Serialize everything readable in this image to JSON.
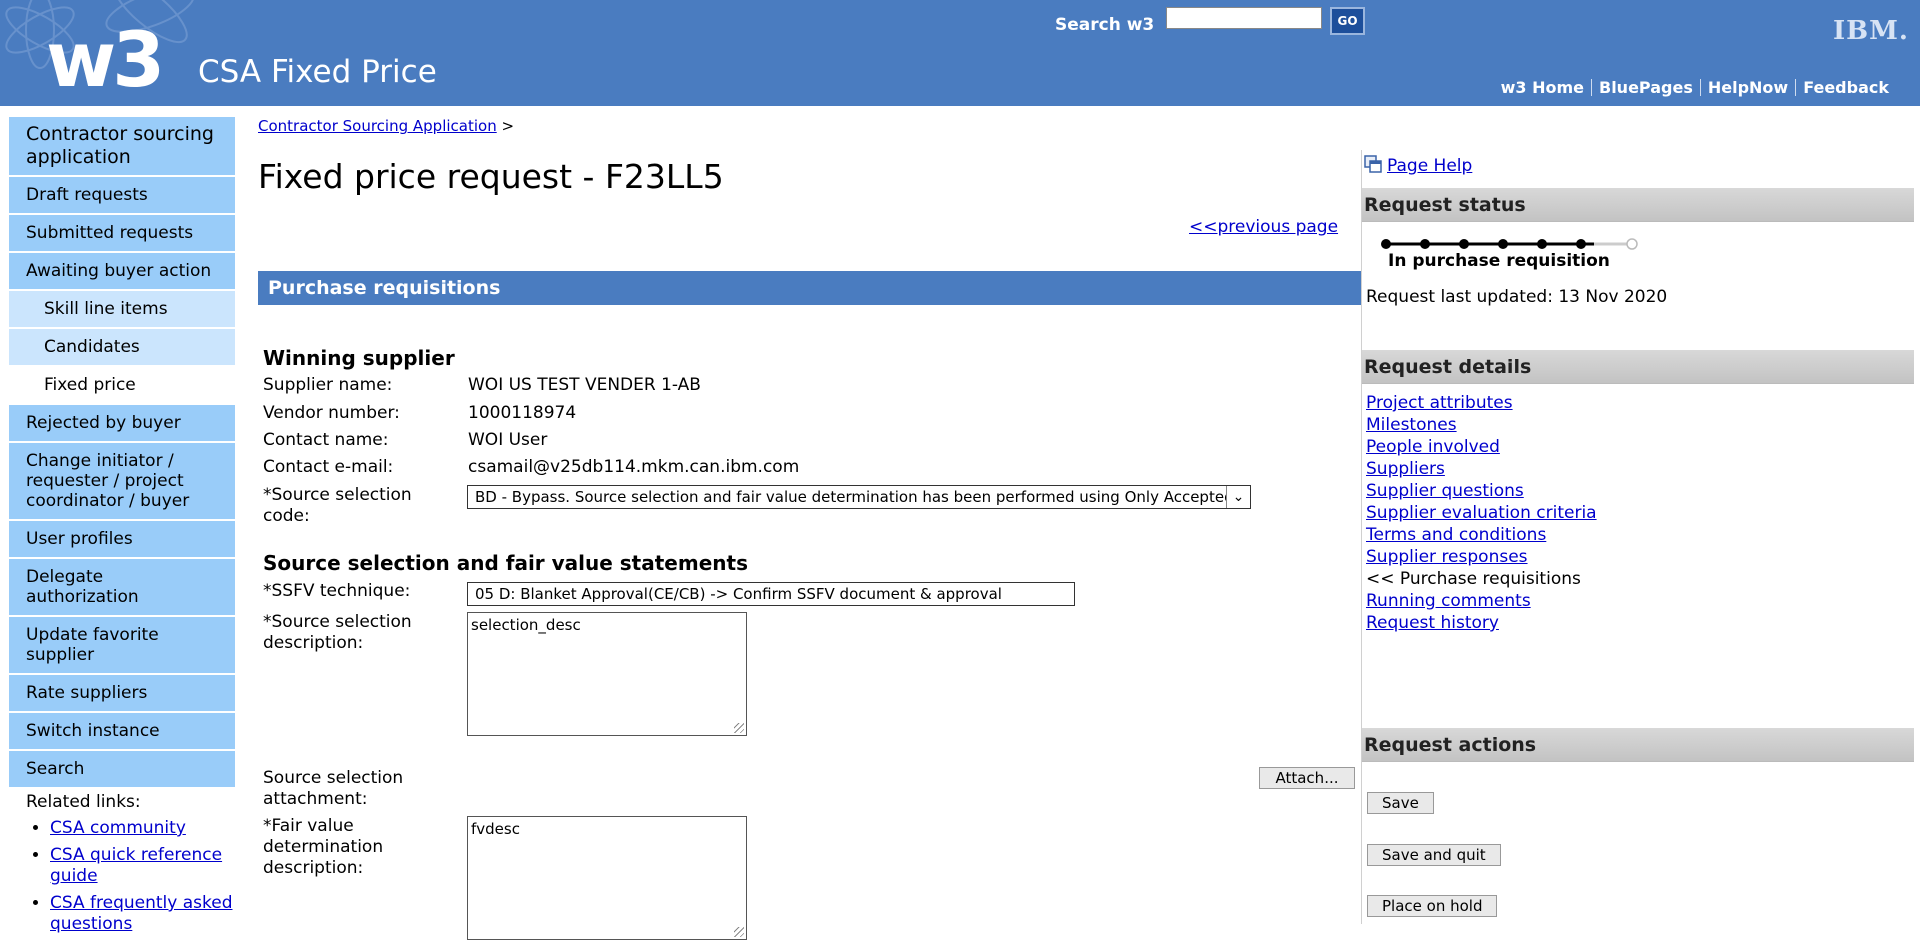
{
  "header": {
    "logo": "w3",
    "app_title": "CSA Fixed Price",
    "search_label": "Search w3",
    "search_value": "",
    "go_label": "GO",
    "ibm_logo": "IBM.",
    "links": [
      "w3 Home",
      "BluePages",
      "HelpNow",
      "Feedback"
    ]
  },
  "leftnav": {
    "title": "Contractor sourcing application",
    "items": [
      "Draft requests",
      "Submitted requests",
      "Awaiting buyer action",
      "Skill line items",
      "Candidates",
      "Fixed price",
      "Rejected by buyer",
      "Change initiator / requester / project coordinator / buyer",
      "User profiles",
      "Delegate authorization",
      "Update favorite supplier",
      "Rate suppliers",
      "Switch instance",
      "Search"
    ],
    "related_title": "Related links:",
    "related_links": [
      "CSA community",
      "CSA quick reference guide",
      "CSA frequently asked questions"
    ]
  },
  "main": {
    "breadcrumb_link": "Contractor Sourcing Application",
    "breadcrumb_sep": ">",
    "page_title": "Fixed price request - F23LL5",
    "prev_link": "<<previous page",
    "section_title": "Purchase requisitions",
    "winning_supplier_title": "Winning supplier",
    "supplier_name_label": "Supplier name:",
    "supplier_name": "WOI US TEST VENDER 1-AB",
    "vendor_number_label": "Vendor number:",
    "vendor_number": "1000118974",
    "contact_name_label": "Contact name:",
    "contact_name": "WOI User",
    "contact_email_label": "Contact e-mail:",
    "contact_email": "csamail@v25db114.mkm.can.ibm.com",
    "source_code_label": "*Source selection code:",
    "source_code_value": "BD - Bypass. Source selection and fair value determination has been performed using Only Accepted",
    "ssfv_title": "Source selection and fair value statements",
    "ssfv_technique_label": "*SSFV technique:",
    "ssfv_technique_value": "05 D: Blanket Approval(CE/CB) -> Confirm SSFV document & approval",
    "source_desc_label": "*Source selection description:",
    "source_desc_value": "selection_desc",
    "attachment_label": "Source selection attachment:",
    "attach_button": "Attach...",
    "fair_value_label": "*Fair value determination description:",
    "fair_value_value": "fvdesc"
  },
  "rightpanel": {
    "page_help": "Page Help",
    "status_title": "Request status",
    "status_progress": "6 of 7",
    "status_label": "In purchase requisition",
    "last_updated": "Request last updated: 13 Nov 2020",
    "details_title": "Request details",
    "details_links": [
      "Project attributes",
      "Milestones",
      "People involved",
      "Suppliers",
      "Supplier questions",
      "Supplier evaluation criteria",
      "Terms and conditions",
      "Supplier responses",
      "<< Purchase requisitions",
      "Running comments",
      "Request history"
    ],
    "actions_title": "Request actions",
    "actions": [
      "Save",
      "Save and quit",
      "Place on hold"
    ]
  }
}
